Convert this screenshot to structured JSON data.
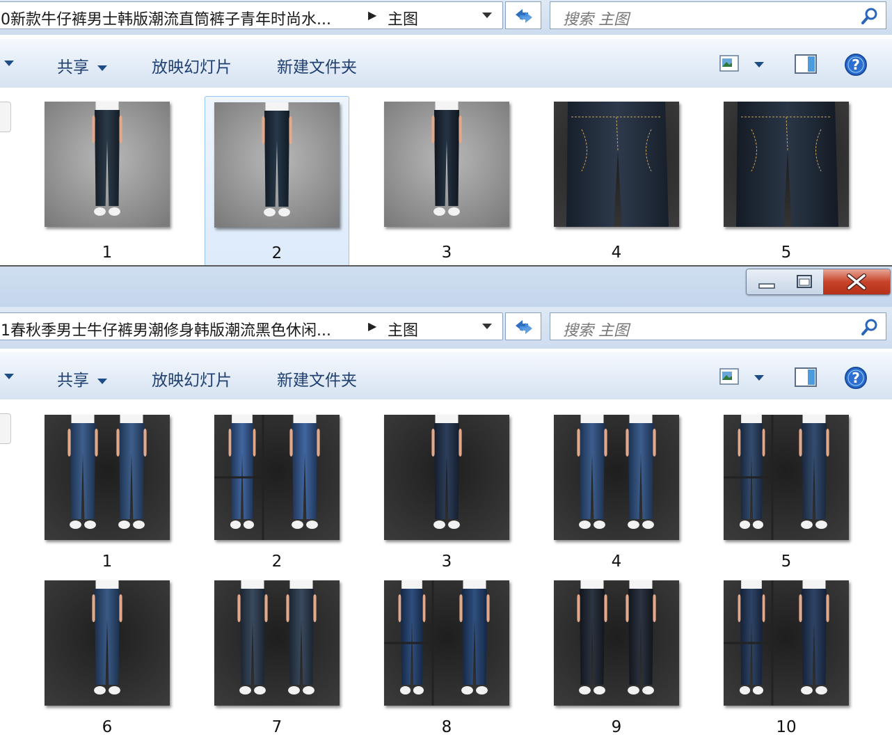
{
  "window1": {
    "address": {
      "path": "0新款牛仔裤男士韩版潮流直筒裤子青年时尚水...",
      "crumb": "主图"
    },
    "search": {
      "placeholder": "搜索 主图"
    },
    "toolbar": {
      "share_label": "共享",
      "slideshow_label": "放映幻灯片",
      "new_folder_label": "新建文件夹"
    },
    "files": [
      "1",
      "2",
      "3",
      "4",
      "5"
    ],
    "selected": "2"
  },
  "window2": {
    "address": {
      "path": "1春秋季男士牛仔裤男潮修身韩版潮流黑色休闲...",
      "crumb": "主图"
    },
    "search": {
      "placeholder": "搜索 主图"
    },
    "toolbar": {
      "share_label": "共享",
      "slideshow_label": "放映幻灯片",
      "new_folder_label": "新建文件夹"
    },
    "files": [
      "1",
      "2",
      "3",
      "4",
      "5",
      "6",
      "7",
      "8",
      "9",
      "10"
    ]
  },
  "colors": {
    "toolbar_text": "#1e3f6f",
    "close_button": "#c7432a",
    "selection_border": "#99c4ee"
  },
  "icons": [
    "refresh-icon",
    "search-icon",
    "view-options-icon",
    "preview-pane-icon",
    "help-icon",
    "minimize-icon",
    "maximize-icon",
    "close-icon",
    "jeans-thumbnail"
  ]
}
